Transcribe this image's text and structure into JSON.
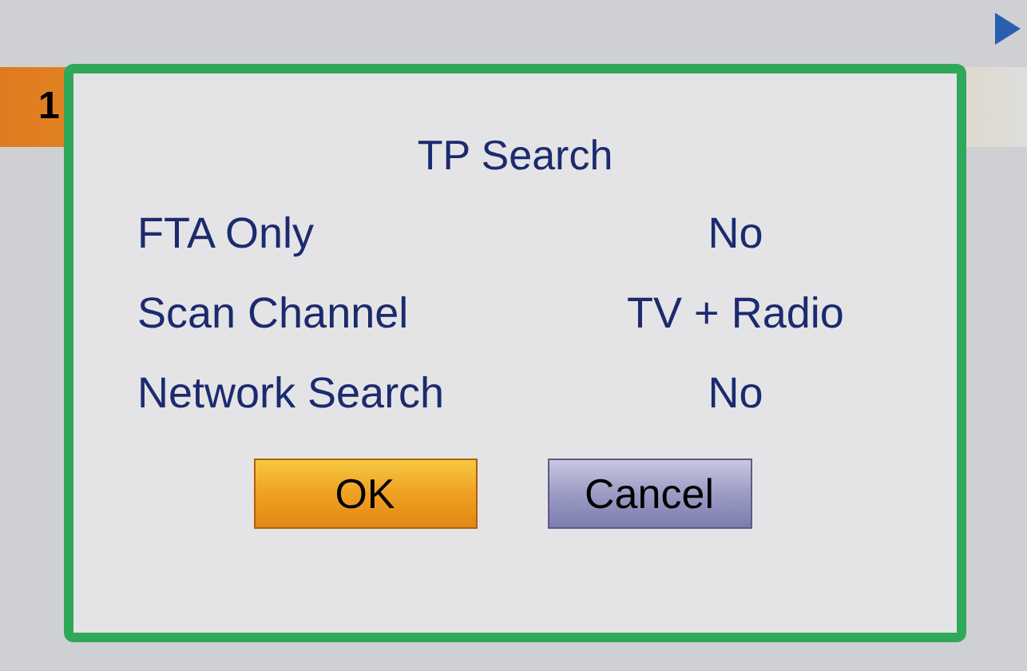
{
  "list": {
    "row_number": "1"
  },
  "dialog": {
    "title": "TP Search",
    "fields": [
      {
        "label": "FTA Only",
        "value": "No"
      },
      {
        "label": "Scan Channel",
        "value": "TV + Radio"
      },
      {
        "label": "Network Search",
        "value": "No"
      }
    ],
    "buttons": [
      {
        "label": "OK",
        "selected": true
      },
      {
        "label": "Cancel",
        "selected": false
      }
    ]
  }
}
